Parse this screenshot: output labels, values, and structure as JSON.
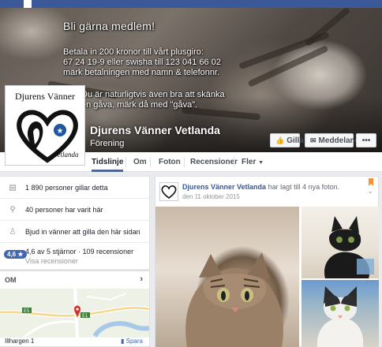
{
  "cover": {
    "heading": "Bli gärna medlem!",
    "lines": [
      "Betala in 200 kronor till vårt plusgiro:",
      "67 24 19-9 eller swisha till 123 041 66 02",
      "märk betalningen med namn & telefonnr."
    ],
    "lines2": [
      "Du är naturligtvis även bra att skänka",
      "en gåva, märk då med \"gåva\"."
    ]
  },
  "profile": {
    "logo_title": "Djurens Vänner",
    "logo_script": "Vetlanda",
    "name": "Djurens Vänner Vetlanda",
    "category": "Förening"
  },
  "actions": {
    "like": "Gilla",
    "message": "Meddelanden",
    "more": "•••"
  },
  "tabs": [
    "Tidslinje",
    "Om",
    "Foton",
    "Recensioner",
    "Fler"
  ],
  "tab_more_caret": "▼",
  "about_rows": [
    {
      "icon": "like-icon",
      "text": "1 890 personer gillar detta"
    },
    {
      "icon": "location-pin-icon",
      "text": "40 personer har varit här"
    },
    {
      "icon": "invite-icon",
      "text": "Bjud in vänner att gilla den här sidan"
    }
  ],
  "rating": {
    "badge": "4,6 ★",
    "text": "4,6 av 5 stjärnor · 109 recensioner",
    "sub": "Visa recensioner"
  },
  "om": {
    "title": "OM",
    "map_labels": [
      "E5",
      "E1"
    ],
    "footer_left": "Illhargen 1",
    "footer_save": "Spara"
  },
  "post": {
    "page_name": "Djurens Vänner Vetlanda",
    "action_text": "har lagt till 4 nya foton.",
    "date": "den 11 oktober 2015"
  },
  "colors": {
    "brand": "#3b5998",
    "link": "#365899",
    "accent": "#4267b2"
  }
}
